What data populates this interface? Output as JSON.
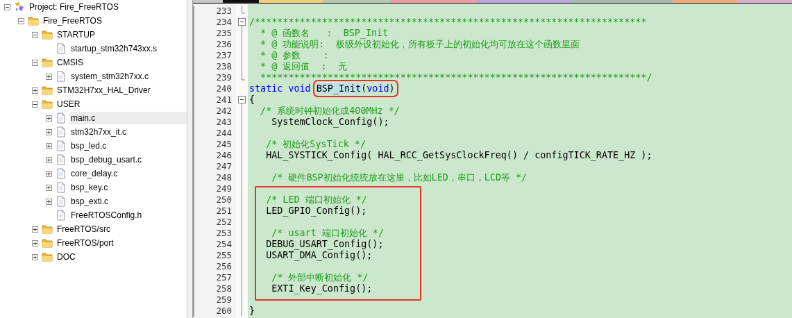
{
  "project_tree": [
    {
      "label": "Project: Fire_FreeRTOS",
      "kind": "project",
      "expanded": true,
      "selected": false,
      "children": [
        {
          "label": "Fire_FreeRTOS",
          "kind": "target",
          "expanded": true,
          "selected": false,
          "children": [
            {
              "label": "STARTUP",
              "kind": "folder",
              "expanded": true,
              "selected": false,
              "children": [
                {
                  "label": "startup_stm32h743xx.s",
                  "kind": "file",
                  "selected": false
                }
              ]
            },
            {
              "label": "CMSIS",
              "kind": "folder",
              "expanded": true,
              "selected": false,
              "children": [
                {
                  "label": "system_stm32h7xx.c",
                  "kind": "file",
                  "expanded": false,
                  "selected": false
                }
              ]
            },
            {
              "label": "STM32H7xx_HAL_Driver",
              "kind": "folder",
              "expanded": false,
              "selected": false
            },
            {
              "label": "USER",
              "kind": "folder",
              "expanded": true,
              "selected": false,
              "children": [
                {
                  "label": "main.c",
                  "kind": "file",
                  "expanded": false,
                  "selected": true
                },
                {
                  "label": "stm32h7xx_it.c",
                  "kind": "file",
                  "expanded": false,
                  "selected": false
                },
                {
                  "label": "bsp_led.c",
                  "kind": "file",
                  "expanded": false,
                  "selected": false
                },
                {
                  "label": "bsp_debug_usart.c",
                  "kind": "file",
                  "expanded": false,
                  "selected": false
                },
                {
                  "label": "core_delay.c",
                  "kind": "file",
                  "expanded": false,
                  "selected": false
                },
                {
                  "label": "bsp_key.c",
                  "kind": "file",
                  "expanded": false,
                  "selected": false
                },
                {
                  "label": "bsp_exti.c",
                  "kind": "file",
                  "expanded": false,
                  "selected": false
                },
                {
                  "label": "FreeRTOSConfig.h",
                  "kind": "file",
                  "selected": false
                }
              ]
            },
            {
              "label": "FreeRTOS/src",
              "kind": "folder",
              "expanded": false,
              "selected": false
            },
            {
              "label": "FreeRTOS/port",
              "kind": "folder",
              "expanded": false,
              "selected": false
            },
            {
              "label": "DOC",
              "kind": "folder",
              "expanded": false,
              "selected": false
            }
          ]
        }
      ]
    }
  ],
  "editor_tabs": [
    {
      "color": "#111111"
    },
    {
      "color": "#f3d27a"
    },
    {
      "color": "#b8c8b0"
    },
    {
      "color": "#eaa0a0"
    },
    {
      "color": "#b8a8dc"
    },
    {
      "color": "#a8b8b0"
    },
    {
      "color": "#f4ac78"
    },
    {
      "color": "#d8b0c8"
    }
  ],
  "lines": [
    {
      "kind": "line",
      "number": "233",
      "fold": {
        "kind": "end"
      }
    },
    {
      "kind": "line",
      "number": "234",
      "fold": {
        "kind": "collapse"
      },
      "segments": [
        {
          "kind": "comment",
          "text": "/**********************************************************************"
        }
      ]
    },
    {
      "kind": "line",
      "number": "235",
      "fold": {
        "kind": "bar"
      },
      "segments": [
        {
          "kind": "comment",
          "text": "  * @ 函数名   :  BSP_Init"
        }
      ]
    },
    {
      "kind": "line",
      "number": "236",
      "fold": {
        "kind": "bar"
      },
      "segments": [
        {
          "kind": "comment",
          "text": "  * @ 功能说明:  板级外设初始化，所有板子上的初始化均可放在这个函数里面"
        }
      ]
    },
    {
      "kind": "line",
      "number": "237",
      "fold": {
        "kind": "bar"
      },
      "segments": [
        {
          "kind": "comment",
          "text": "  * @ 参数    :"
        }
      ]
    },
    {
      "kind": "line",
      "number": "238",
      "fold": {
        "kind": "bar"
      },
      "segments": [
        {
          "kind": "comment",
          "text": "  * @ 返回值  :  无"
        }
      ]
    },
    {
      "kind": "line",
      "number": "239",
      "fold": {
        "kind": "end"
      },
      "segments": [
        {
          "kind": "comment",
          "text": "  *********************************************************************/"
        }
      ]
    },
    {
      "kind": "line",
      "number": "240",
      "segments": [
        {
          "kind": "keyword",
          "text": "static void "
        },
        {
          "kind": "boxed",
          "segments": [
            {
              "kind": "plain",
              "text": "BSP_Init",
              "selected": true
            },
            {
              "kind": "plain",
              "text": "("
            },
            {
              "kind": "keyword",
              "text": "void"
            },
            {
              "kind": "plain",
              "text": ")"
            }
          ]
        }
      ]
    },
    {
      "kind": "line",
      "number": "241",
      "fold": {
        "kind": "collapse"
      },
      "segments": [
        {
          "kind": "plain",
          "text": "{"
        }
      ]
    },
    {
      "kind": "line",
      "number": "242",
      "fold": {
        "kind": "bar"
      },
      "segments": [
        {
          "kind": "comment",
          "text": "  /* 系统时钟初始化成400MHz */"
        }
      ]
    },
    {
      "kind": "line",
      "number": "243",
      "fold": {
        "kind": "bar"
      },
      "segments": [
        {
          "kind": "plain",
          "text": "    SystemClock_Config();"
        }
      ]
    },
    {
      "kind": "line",
      "number": "244",
      "fold": {
        "kind": "bar"
      }
    },
    {
      "kind": "line",
      "number": "245",
      "fold": {
        "kind": "bar"
      },
      "segments": [
        {
          "kind": "comment",
          "text": "   /* 初始化SysTick */"
        }
      ]
    },
    {
      "kind": "line",
      "number": "246",
      "fold": {
        "kind": "bar"
      },
      "segments": [
        {
          "kind": "plain",
          "text": "   HAL_SYSTICK_Config( HAL_RCC_GetSysClockFreq() / configTICK_RATE_HZ );"
        }
      ]
    },
    {
      "kind": "line",
      "number": "247",
      "fold": {
        "kind": "bar"
      }
    },
    {
      "kind": "line",
      "number": "248",
      "fold": {
        "kind": "bar"
      },
      "segments": [
        {
          "kind": "comment",
          "text": "    /* 硬件BSP初始化统统放在这里，比如LED，串口，LCD等 */"
        }
      ]
    },
    {
      "kind": "line",
      "number": "249",
      "fold": {
        "kind": "bar"
      }
    },
    {
      "kind": "boxed_block",
      "lines": [
        {
          "kind": "line",
          "number": "250",
          "fold": {
            "kind": "bar"
          },
          "segments": [
            {
              "kind": "comment",
              "text": "   /* LED 端口初始化 */"
            }
          ]
        },
        {
          "kind": "line",
          "number": "251",
          "fold": {
            "kind": "bar"
          },
          "segments": [
            {
              "kind": "plain",
              "text": "   LED_GPIO_Config();"
            }
          ]
        },
        {
          "kind": "line",
          "number": "252",
          "fold": {
            "kind": "bar"
          }
        },
        {
          "kind": "line",
          "number": "253",
          "fold": {
            "kind": "bar"
          },
          "segments": [
            {
              "kind": "comment",
              "text": "    /* usart 端口初始化 */"
            }
          ]
        },
        {
          "kind": "line",
          "number": "254",
          "fold": {
            "kind": "bar"
          },
          "segments": [
            {
              "kind": "plain",
              "text": "   DEBUG_USART_Config();"
            }
          ]
        },
        {
          "kind": "line",
          "number": "255",
          "fold": {
            "kind": "bar"
          },
          "segments": [
            {
              "kind": "plain",
              "text": "   USART_DMA_Config();"
            }
          ]
        },
        {
          "kind": "line",
          "number": "256",
          "fold": {
            "kind": "bar"
          }
        },
        {
          "kind": "line",
          "number": "257",
          "fold": {
            "kind": "bar"
          },
          "segments": [
            {
              "kind": "comment",
              "text": "    /* 外部中断初始化 */"
            }
          ]
        },
        {
          "kind": "line",
          "number": "258",
          "fold": {
            "kind": "bar"
          },
          "segments": [
            {
              "kind": "plain",
              "text": "    EXTI_Key_Config();"
            }
          ]
        },
        {
          "kind": "line",
          "number": "259",
          "fold": {
            "kind": "bar"
          }
        }
      ]
    },
    {
      "kind": "line",
      "number": "260",
      "fold": {
        "kind": "bar"
      },
      "segments": [
        {
          "kind": "plain",
          "text": "}"
        }
      ]
    }
  ]
}
